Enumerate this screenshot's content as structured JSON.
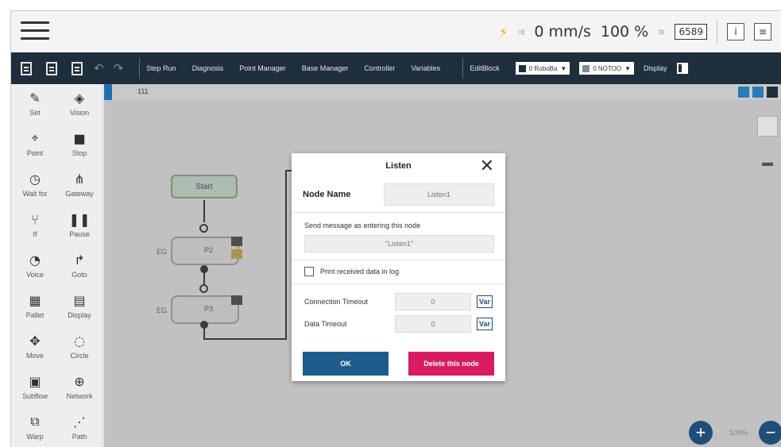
{
  "status_bar": {
    "speed": "0 mm/s",
    "percent": "100 %",
    "counter": "6589"
  },
  "toolbar": {
    "menu_items": [
      "Step Run",
      "Diagnosis",
      "Point Manager",
      "Base Manager",
      "Controller",
      "Variables"
    ],
    "editblock": "EditBlock",
    "robot_select": "0 RoboBa",
    "tool_select": "0 NOTOO",
    "display": "Display"
  },
  "palette": {
    "items": [
      {
        "label": "Set",
        "icon": "wrench-icon",
        "glyph": "✎"
      },
      {
        "label": "Vision",
        "icon": "vision-icon",
        "glyph": "◈"
      },
      {
        "label": "Point",
        "icon": "point-icon",
        "glyph": "⌖"
      },
      {
        "label": "Stop",
        "icon": "stop-icon",
        "glyph": "■"
      },
      {
        "label": "Wait for",
        "icon": "clock-icon",
        "glyph": "◷"
      },
      {
        "label": "Gateway",
        "icon": "gateway-icon",
        "glyph": "⋔"
      },
      {
        "label": "If",
        "icon": "if-icon",
        "glyph": "⑂"
      },
      {
        "label": "Pause",
        "icon": "pause-icon",
        "glyph": "❚❚"
      },
      {
        "label": "Voice",
        "icon": "voice-icon",
        "glyph": "◔"
      },
      {
        "label": "Goto",
        "icon": "goto-icon",
        "glyph": "↱"
      },
      {
        "label": "Pallet",
        "icon": "pallet-icon",
        "glyph": "▦"
      },
      {
        "label": "Display",
        "icon": "display-icon",
        "glyph": "▤"
      },
      {
        "label": "Move",
        "icon": "move-icon",
        "glyph": "✥"
      },
      {
        "label": "Circle",
        "icon": "circle-icon",
        "glyph": "◌"
      },
      {
        "label": "Subflow",
        "icon": "subflow-icon",
        "glyph": "▣"
      },
      {
        "label": "Network",
        "icon": "network-icon",
        "glyph": "⊕"
      },
      {
        "label": "Warp",
        "icon": "warp-icon",
        "glyph": "⧉"
      },
      {
        "label": "Path",
        "icon": "path-icon",
        "glyph": "⋰"
      }
    ]
  },
  "canvas": {
    "tab_label": "111",
    "start_label": "Start",
    "point_nodes": [
      {
        "label": "P2",
        "side": "EG"
      },
      {
        "label": "P3",
        "side": "EG"
      }
    ],
    "zoom": "100%"
  },
  "dialog": {
    "title": "Listen",
    "node_name_label": "Node Name",
    "node_name_value": "Listen1",
    "send_message_label": "Send message as entering this node",
    "send_message_value": "\"Listen1\"",
    "print_label": "Print received data in log",
    "print_checked": false,
    "connection_timeout_label": "Connection Timeout",
    "connection_timeout_value": "0",
    "data_timeout_label": "Data Timeout",
    "data_timeout_value": "0",
    "var_label": "Var",
    "ok_label": "OK",
    "delete_label": "Delete this node"
  },
  "colors": {
    "toolbar": "#1f2e3d",
    "ok": "#1e5c8d",
    "delete": "#d91c61",
    "start_node": "#bcd0c4",
    "zoom_button": "#1f4e79"
  }
}
